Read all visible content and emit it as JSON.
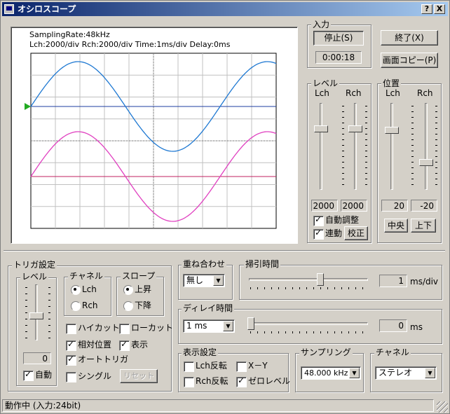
{
  "window": {
    "title": "オシロスコープ",
    "help_label": "?",
    "close_label": "X"
  },
  "scope": {
    "info_line1": "SamplingRate:48kHz",
    "info_line2": "Lch:2000/div   Rch:2000/div   Time:1ms/div   Delay:0ms",
    "lch_color": "#1e78d2",
    "rch_color": "#e040c0",
    "trigger_color": "#22aa22"
  },
  "input": {
    "label": "入力",
    "stop_button": "停止(S)",
    "elapsed": "0:00:18"
  },
  "actions": {
    "exit_button": "終了(X)",
    "copy_button": "画面コピー(P)"
  },
  "level": {
    "label": "レベル",
    "lch_label": "Lch",
    "rch_label": "Rch",
    "lch_value": "2000",
    "rch_value": "2000",
    "auto_adjust": "自動調整",
    "linked": "連動",
    "calibrate_button": "校正"
  },
  "position": {
    "label": "位置",
    "lch_label": "Lch",
    "rch_label": "Rch",
    "lch_value": "20",
    "rch_value": "-20",
    "center_button": "中央",
    "down_button": "上下"
  },
  "trigger": {
    "label": "トリガ設定",
    "level_label": "レベル",
    "level_value": "0",
    "auto": "自動",
    "channel_label": "チャネル",
    "channel_lch": "Lch",
    "channel_rch": "Rch",
    "slope_label": "スロープ",
    "slope_up": "上昇",
    "slope_down": "下降",
    "highcut": "ハイカット",
    "lowcut": "ローカット",
    "relative": "相対位置",
    "display": "表示",
    "autotrigger": "オートトリガ",
    "single": "シングル",
    "reset_button": "リセット"
  },
  "overlay": {
    "label": "重ね合わせ",
    "value": "無し"
  },
  "sweep": {
    "label": "掃引時間",
    "value": "1",
    "unit": "ms/div"
  },
  "delay": {
    "label": "ディレイ時間",
    "select": "1 ms",
    "value": "0",
    "unit": "ms"
  },
  "display_settings": {
    "label": "表示設定",
    "lch_invert": "Lch反転",
    "xy": "X－Y",
    "rch_invert": "Rch反転",
    "zero_level": "ゼロレベル"
  },
  "sampling": {
    "label": "サンプリング",
    "value": "48.000 kHz"
  },
  "channel": {
    "label": "チャネル",
    "value": "ステレオ"
  },
  "status": {
    "text": "動作中 (入力:24bit)"
  }
}
